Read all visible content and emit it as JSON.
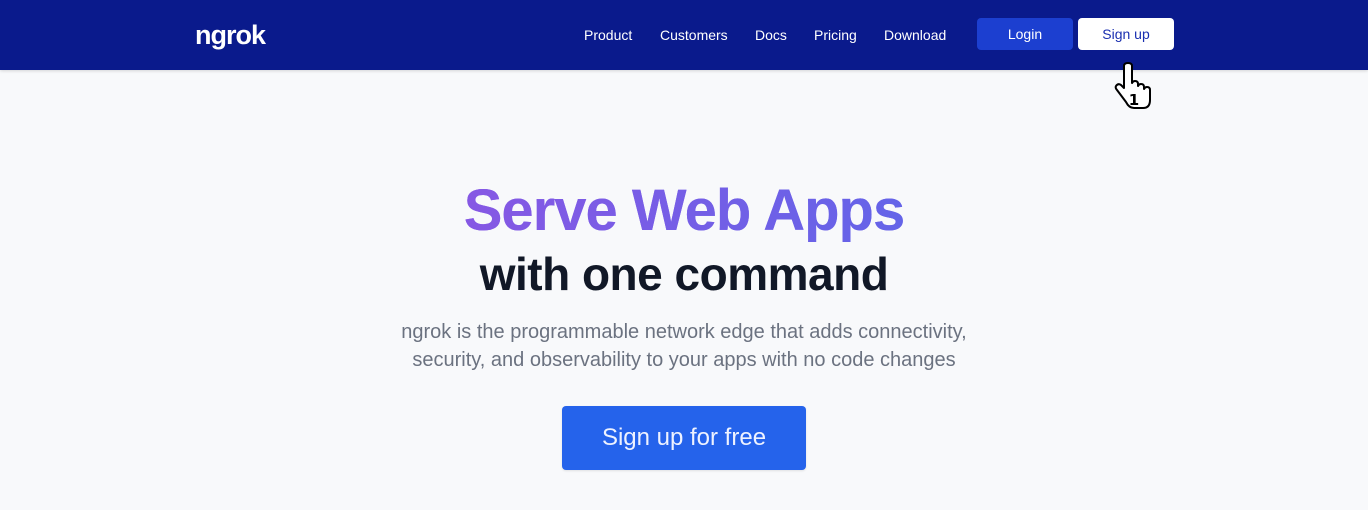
{
  "header": {
    "logo": "ngrok",
    "nav": [
      {
        "label": "Product"
      },
      {
        "label": "Customers"
      },
      {
        "label": "Docs"
      },
      {
        "label": "Pricing"
      },
      {
        "label": "Download"
      }
    ],
    "login_label": "Login",
    "signup_label": "Sign up"
  },
  "cursor": {
    "icon": "hand-pointer-icon",
    "badge": "1"
  },
  "hero": {
    "title": "Serve Web Apps",
    "subtitle": "with one command",
    "description_line1": "ngrok is the programmable network edge that adds connectivity,",
    "description_line2": "security, and observability to your apps with no code changes",
    "cta_label": "Sign up for free"
  },
  "colors": {
    "navbar": "#0a1a8c",
    "login_button": "#1c3fd0",
    "cta_button": "#2563eb",
    "title_gradient_start": "#8658e4",
    "title_gradient_end": "#6464e8",
    "background": "#f8f9fb"
  }
}
